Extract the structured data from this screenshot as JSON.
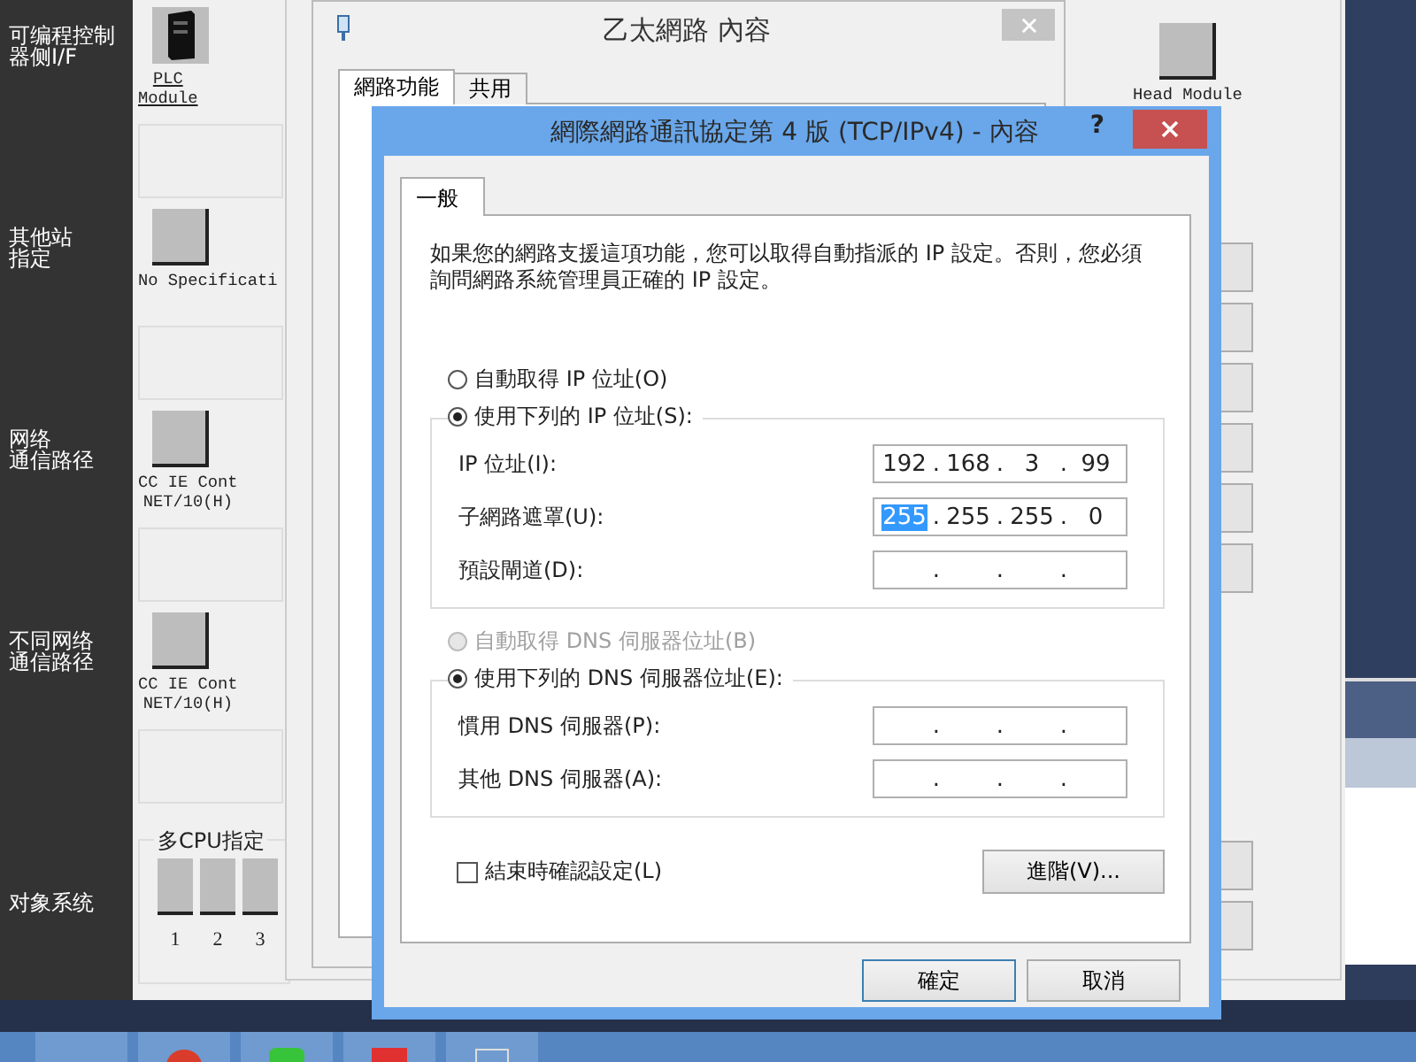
{
  "config_view": {
    "rows": [
      {
        "label_lines": [
          "可编程控制",
          "器侧I/F"
        ],
        "module": {
          "kind": "plc",
          "label": "PLC\nModule",
          "selected": true
        }
      },
      {
        "label_lines": [
          "其他站",
          "指定"
        ],
        "module": {
          "kind": "plain",
          "label": "No Specificati",
          "selected": false
        }
      },
      {
        "label_lines": [
          "网络",
          "通信路径"
        ],
        "module": {
          "kind": "plain",
          "label": "CC IE Cont\nNET/10(H)",
          "selected": false
        }
      },
      {
        "label_lines": [
          "不同网络",
          "通信路径"
        ],
        "module": {
          "kind": "plain",
          "label": "CC IE Cont\nNET/10(H)",
          "selected": false
        }
      },
      {
        "label_lines": [
          "对象系统"
        ],
        "multi_cpu": {
          "title": "多CPU指定",
          "slots": [
            "1",
            "2",
            "3"
          ]
        }
      }
    ],
    "head_module": {
      "label": "Head Module"
    }
  },
  "ethernet_dialog": {
    "title": "乙太網路 內容",
    "tabs": [
      {
        "label": "網路功能",
        "selected": true
      },
      {
        "label": "共用",
        "selected": false
      }
    ]
  },
  "tcp_dialog": {
    "title": "網際網路通訊協定第 4 版 (TCP/IPv4) - 內容",
    "help": "?",
    "tabs": [
      {
        "label": "一般",
        "selected": true
      }
    ],
    "description": "如果您的網路支援這項功能，您可以取得自動指派的 IP 設定。否則，您必須詢問網路系統管理員正確的 IP 設定。",
    "sections": [
      {
        "auto": {
          "label": "自動取得 IP 位址(O)",
          "selected": false,
          "disabled": false
        },
        "manual": {
          "label": "使用下列的 IP 位址(S):",
          "selected": true
        },
        "fields": [
          {
            "label": "IP 位址(I):",
            "separators": [
              ".",
              ".",
              "."
            ],
            "octets": [
              {
                "text": "192",
                "selected": false
              },
              {
                "text": "168",
                "selected": false
              },
              {
                "text": "3",
                "selected": false
              },
              {
                "text": "99",
                "selected": false
              }
            ]
          },
          {
            "label": "子網路遮罩(U):",
            "separators": [
              ".",
              ".",
              "."
            ],
            "octets": [
              {
                "text": "255",
                "selected": true
              },
              {
                "text": "255",
                "selected": false
              },
              {
                "text": "255",
                "selected": false
              },
              {
                "text": "0",
                "selected": false
              }
            ]
          },
          {
            "label": "預設閘道(D):",
            "separators": [
              ".",
              ".",
              "."
            ]
          }
        ]
      },
      {
        "auto": {
          "label": "自動取得 DNS 伺服器位址(B)",
          "selected": false,
          "disabled": true
        },
        "manual": {
          "label": "使用下列的 DNS 伺服器位址(E):",
          "selected": true
        },
        "fields": [
          {
            "label": "慣用 DNS 伺服器(P):",
            "separators": [
              ".",
              ".",
              "."
            ]
          },
          {
            "label": "其他 DNS 伺服器(A):",
            "separators": [
              ".",
              ".",
              "."
            ]
          }
        ]
      }
    ],
    "validate": {
      "label": "結束時確認設定(L)",
      "checked": false
    },
    "advanced_button": "進階(V)...",
    "buttons": [
      {
        "label": "確定",
        "default": true
      },
      {
        "label": "取消",
        "default": false
      }
    ]
  }
}
